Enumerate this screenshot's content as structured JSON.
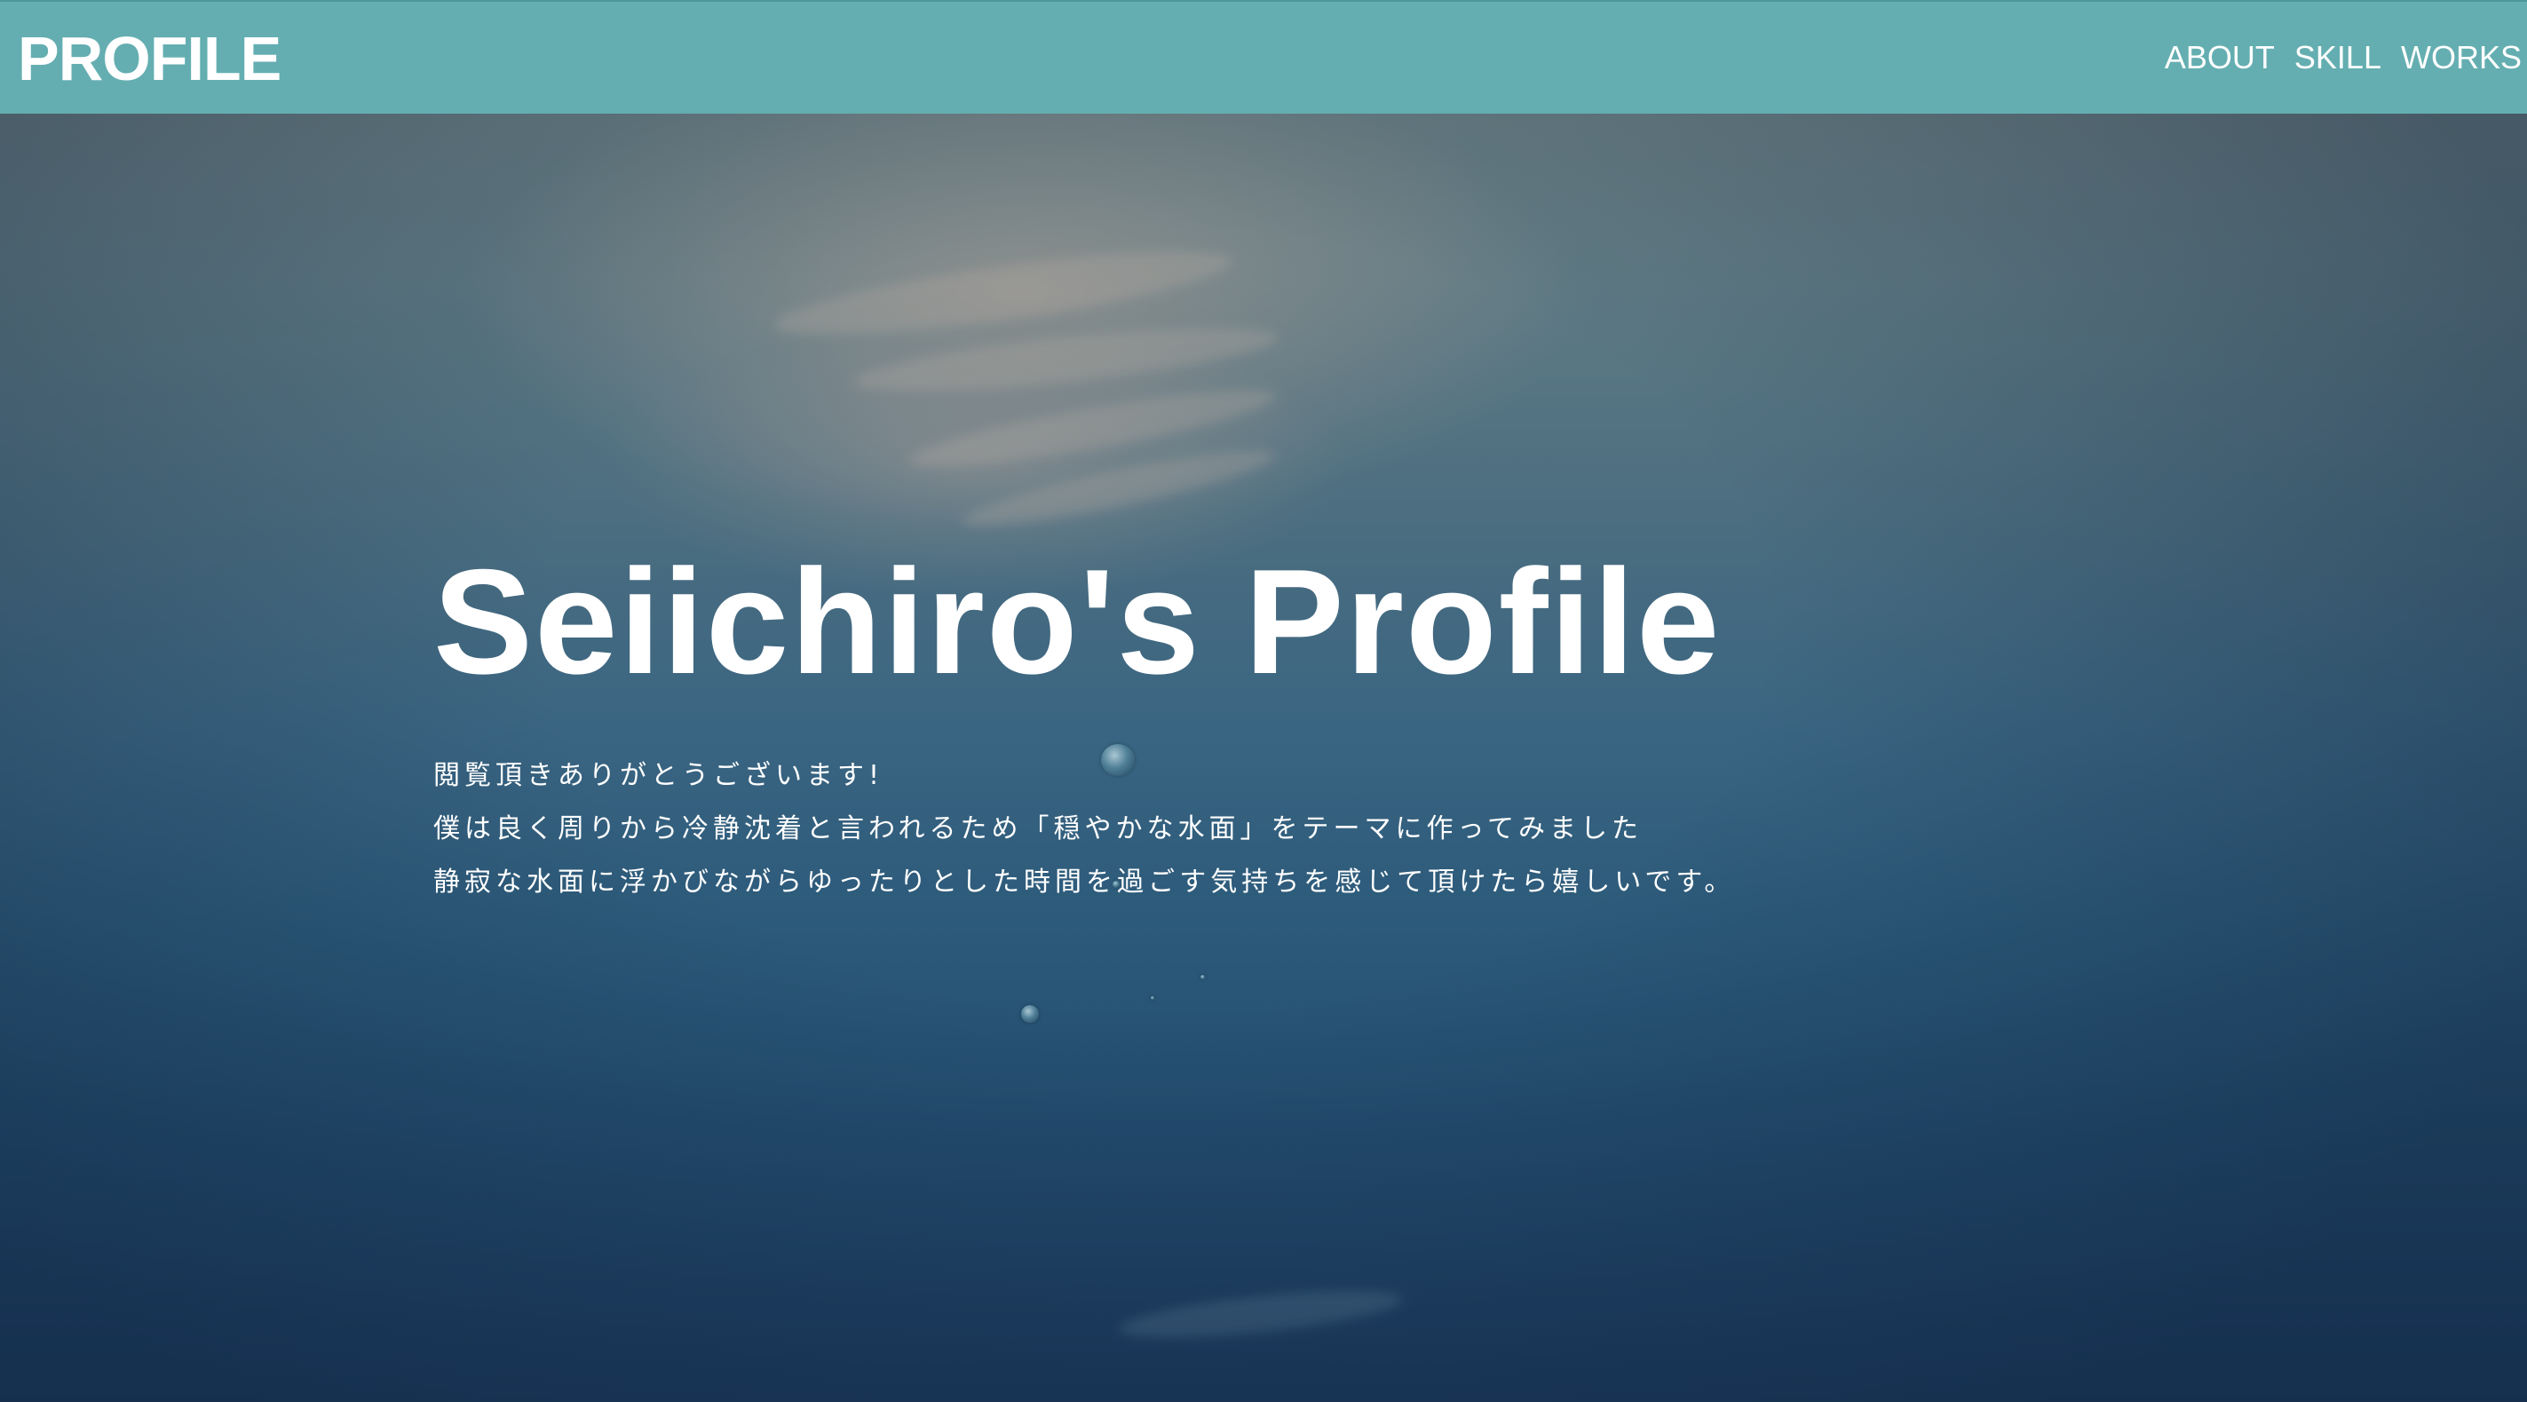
{
  "header": {
    "logo": "PROFILE",
    "nav": [
      {
        "label": "ABOUT"
      },
      {
        "label": "SKILL"
      },
      {
        "label": "WORKS"
      }
    ],
    "background_color": "#64aeb1"
  },
  "hero": {
    "title": "Seiichiro's Profile",
    "lines": [
      "閲覧頂きありがとうございます!",
      "僕は良く周りから冷静沈着と言われるため「穏やかな水面」をテーマに作ってみました",
      "静寂な水面に浮かびながらゆったりとした時間を過ごす気持ちを感じて頂けたら嬉しいです。"
    ]
  },
  "colors": {
    "text": "#ffffff",
    "water_top": "#6c7d80",
    "water_bottom": "#1c3b5e"
  }
}
